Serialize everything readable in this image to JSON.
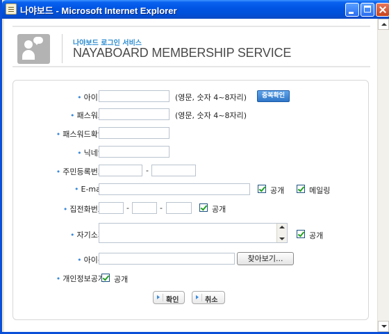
{
  "window": {
    "title": "나야보드 - Microsoft Internet Explorer"
  },
  "header": {
    "subtitle": "나야보드 로그인 서비스",
    "title": "NAYABOARD MEMBERSHIP SERVICE"
  },
  "form": {
    "fields": {
      "id": {
        "label": "아이디",
        "value": "",
        "hint": "(영문, 숫자 4~8자리)"
      },
      "password": {
        "label": "패스워드",
        "value": "",
        "hint": "(영문, 숫자 4~8자리)"
      },
      "password_confirm": {
        "label": "패스워드확인",
        "value": ""
      },
      "nickname": {
        "label": "닉네임",
        "value": ""
      },
      "rrn": {
        "label": "주민등록번호",
        "separator": "-"
      },
      "email": {
        "label": "E-mail",
        "value": ""
      },
      "home_phone": {
        "label": "집전화번호",
        "separator": "-"
      },
      "intro": {
        "label": "자기소개",
        "value": ""
      },
      "icon": {
        "label": "아이콘",
        "value": ""
      },
      "privacy": {
        "label": "개인정보공개"
      }
    },
    "checkboxes": {
      "email_public": {
        "label": "공개",
        "checked": true
      },
      "email_mailing": {
        "label": "메일링",
        "checked": true
      },
      "phone_public": {
        "label": "공개",
        "checked": true
      },
      "intro_public": {
        "label": "공개",
        "checked": true
      },
      "privacy_public": {
        "label": "공개",
        "checked": true
      }
    },
    "buttons": {
      "check_duplicate": "중복확인",
      "browse": "찾아보기...",
      "confirm": "확인",
      "cancel": "취소"
    }
  },
  "colors": {
    "titlebar": "#0054e3",
    "accent": "#3b8ad9",
    "dup_button": "#2f76c8"
  },
  "icons": [
    "app-icon",
    "minimize-icon",
    "maximize-icon",
    "close-icon",
    "member-logo-icon",
    "scroll-up-icon",
    "scroll-down-icon",
    "arrow-right-icon"
  ]
}
